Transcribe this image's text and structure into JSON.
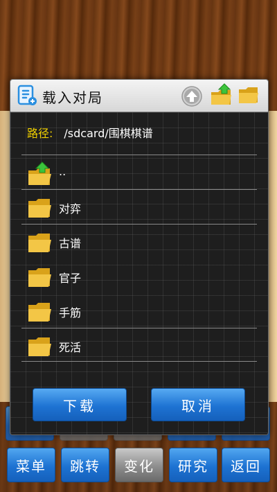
{
  "dialog": {
    "title": "载入对局",
    "path_label": "路径:",
    "path_value": "/sdcard/围棋棋谱",
    "items": [
      {
        "label": "..",
        "icon": "folder-up-icon"
      },
      {
        "label": "对弈",
        "icon": "folder-icon"
      },
      {
        "label": "古谱",
        "icon": "folder-icon"
      },
      {
        "label": "官子",
        "icon": "folder-icon"
      },
      {
        "label": "手筋",
        "icon": "folder-icon"
      },
      {
        "label": "死活",
        "icon": "folder-icon"
      }
    ],
    "download_label": "下载",
    "cancel_label": "取消"
  },
  "toolbar": {
    "menu": "菜单",
    "jump": "跳转",
    "variation": "变化",
    "study": "研究",
    "back": "返回"
  },
  "colors": {
    "accent_blue": "#1e73d3",
    "path_label": "#f0d000",
    "dialog_bg": "#1d1d1d"
  }
}
